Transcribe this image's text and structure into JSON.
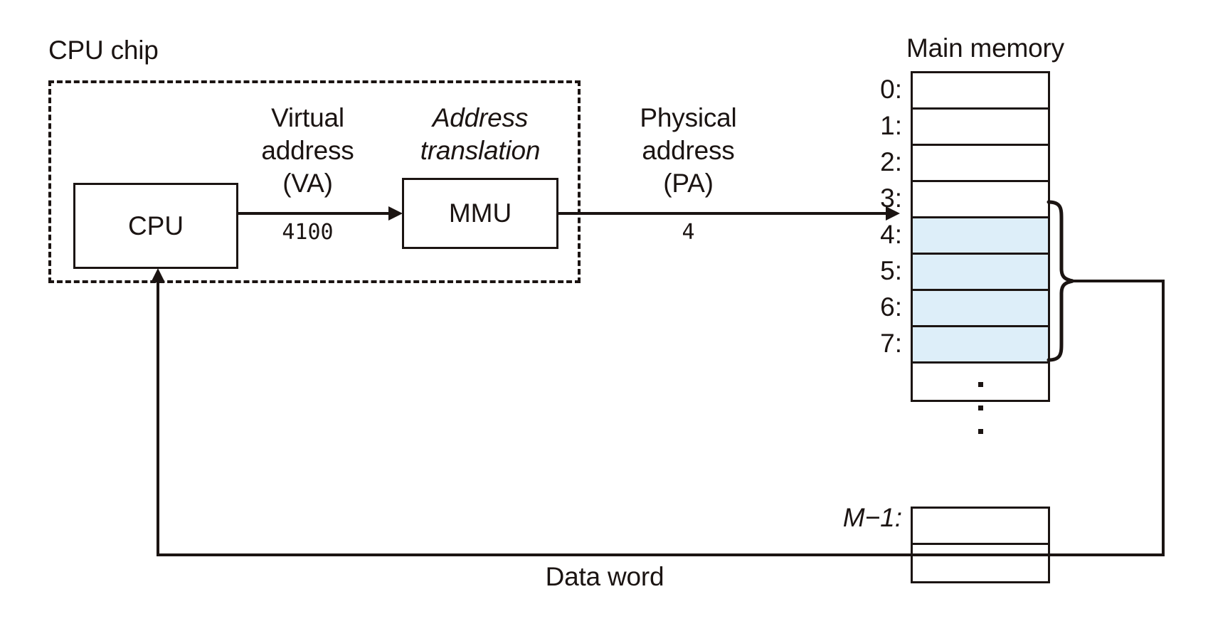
{
  "diagram": {
    "title": "Virtual address translation via MMU",
    "cpu_chip": {
      "label": "CPU chip",
      "cpu_box_label": "CPU",
      "mmu_box_label": "MMU"
    },
    "flows": {
      "virtual_address_label": "Virtual\naddress\n(VA)",
      "virtual_address_value": "4100",
      "address_translation_label": "Address\ntranslation",
      "physical_address_label": "Physical\naddress\n(PA)",
      "physical_address_value": "4",
      "data_word_label": "Data word"
    },
    "main_memory": {
      "title": "Main memory",
      "indices": [
        "0:",
        "1:",
        "2:",
        "3:",
        "4:",
        "5:",
        "6:",
        "7:"
      ],
      "last_index": "M−1:",
      "highlighted_indices": [
        "4:",
        "5:",
        "6:",
        "7:"
      ],
      "ellipsis_glyph": "⋮",
      "rows_before_gap": 9,
      "rows_after_gap": 2
    },
    "colors": {
      "ink": "#1b1412",
      "highlight": "#ddeef9",
      "background": "#ffffff"
    }
  }
}
